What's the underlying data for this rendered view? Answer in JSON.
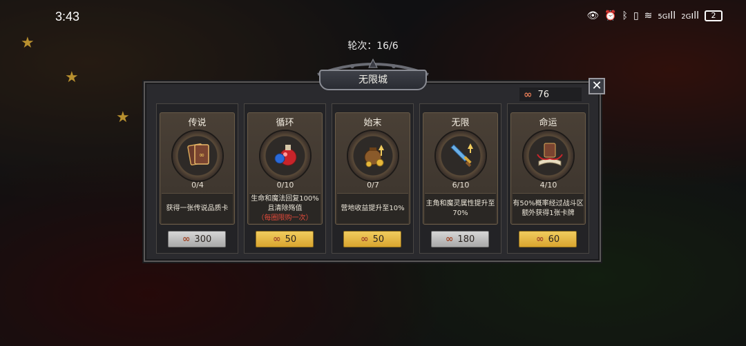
{
  "status_bar": {
    "time": "3:43",
    "icons": [
      "eye-icon",
      "alarm-icon",
      "bluetooth-icon",
      "vibrate-icon",
      "wifi-icon",
      "signal-5g-icon",
      "signal-icon"
    ],
    "signal_labels": [
      "5G",
      "2G"
    ],
    "battery": "2"
  },
  "round_text": "轮次：16/6",
  "panel": {
    "title": "无限城",
    "currency_value": "76",
    "currency_icon": "infinity-icon",
    "close_icon": "close-icon"
  },
  "cards": [
    {
      "title": "传说",
      "progress": "0/4",
      "desc": "获得一张传说品质卡",
      "note": "",
      "price": "300",
      "button_style": "gray",
      "icon": "legend-card-icon"
    },
    {
      "title": "循环",
      "progress": "0/10",
      "desc": "生命和魔法回复100%且清除殇值",
      "note": "（每圈限购一次）",
      "price": "50",
      "button_style": "gold",
      "icon": "potion-icon"
    },
    {
      "title": "始末",
      "progress": "0/7",
      "desc": "营地收益提升至10%",
      "note": "",
      "price": "50",
      "button_style": "gold",
      "icon": "money-bag-icon"
    },
    {
      "title": "无限",
      "progress": "6/10",
      "desc": "主角和魔灵属性提升至70%",
      "note": "",
      "price": "180",
      "button_style": "gray",
      "icon": "sword-icon"
    },
    {
      "title": "命运",
      "progress": "4/10",
      "desc": "有50%概率经过战斗区额外获得1张卡牌",
      "note": "",
      "price": "60",
      "button_style": "gold",
      "icon": "fate-book-icon"
    }
  ],
  "colors": {
    "accent_gold": "#f1cc5e",
    "note_red": "#e24a3a",
    "currency_orange": "#e07a55"
  }
}
